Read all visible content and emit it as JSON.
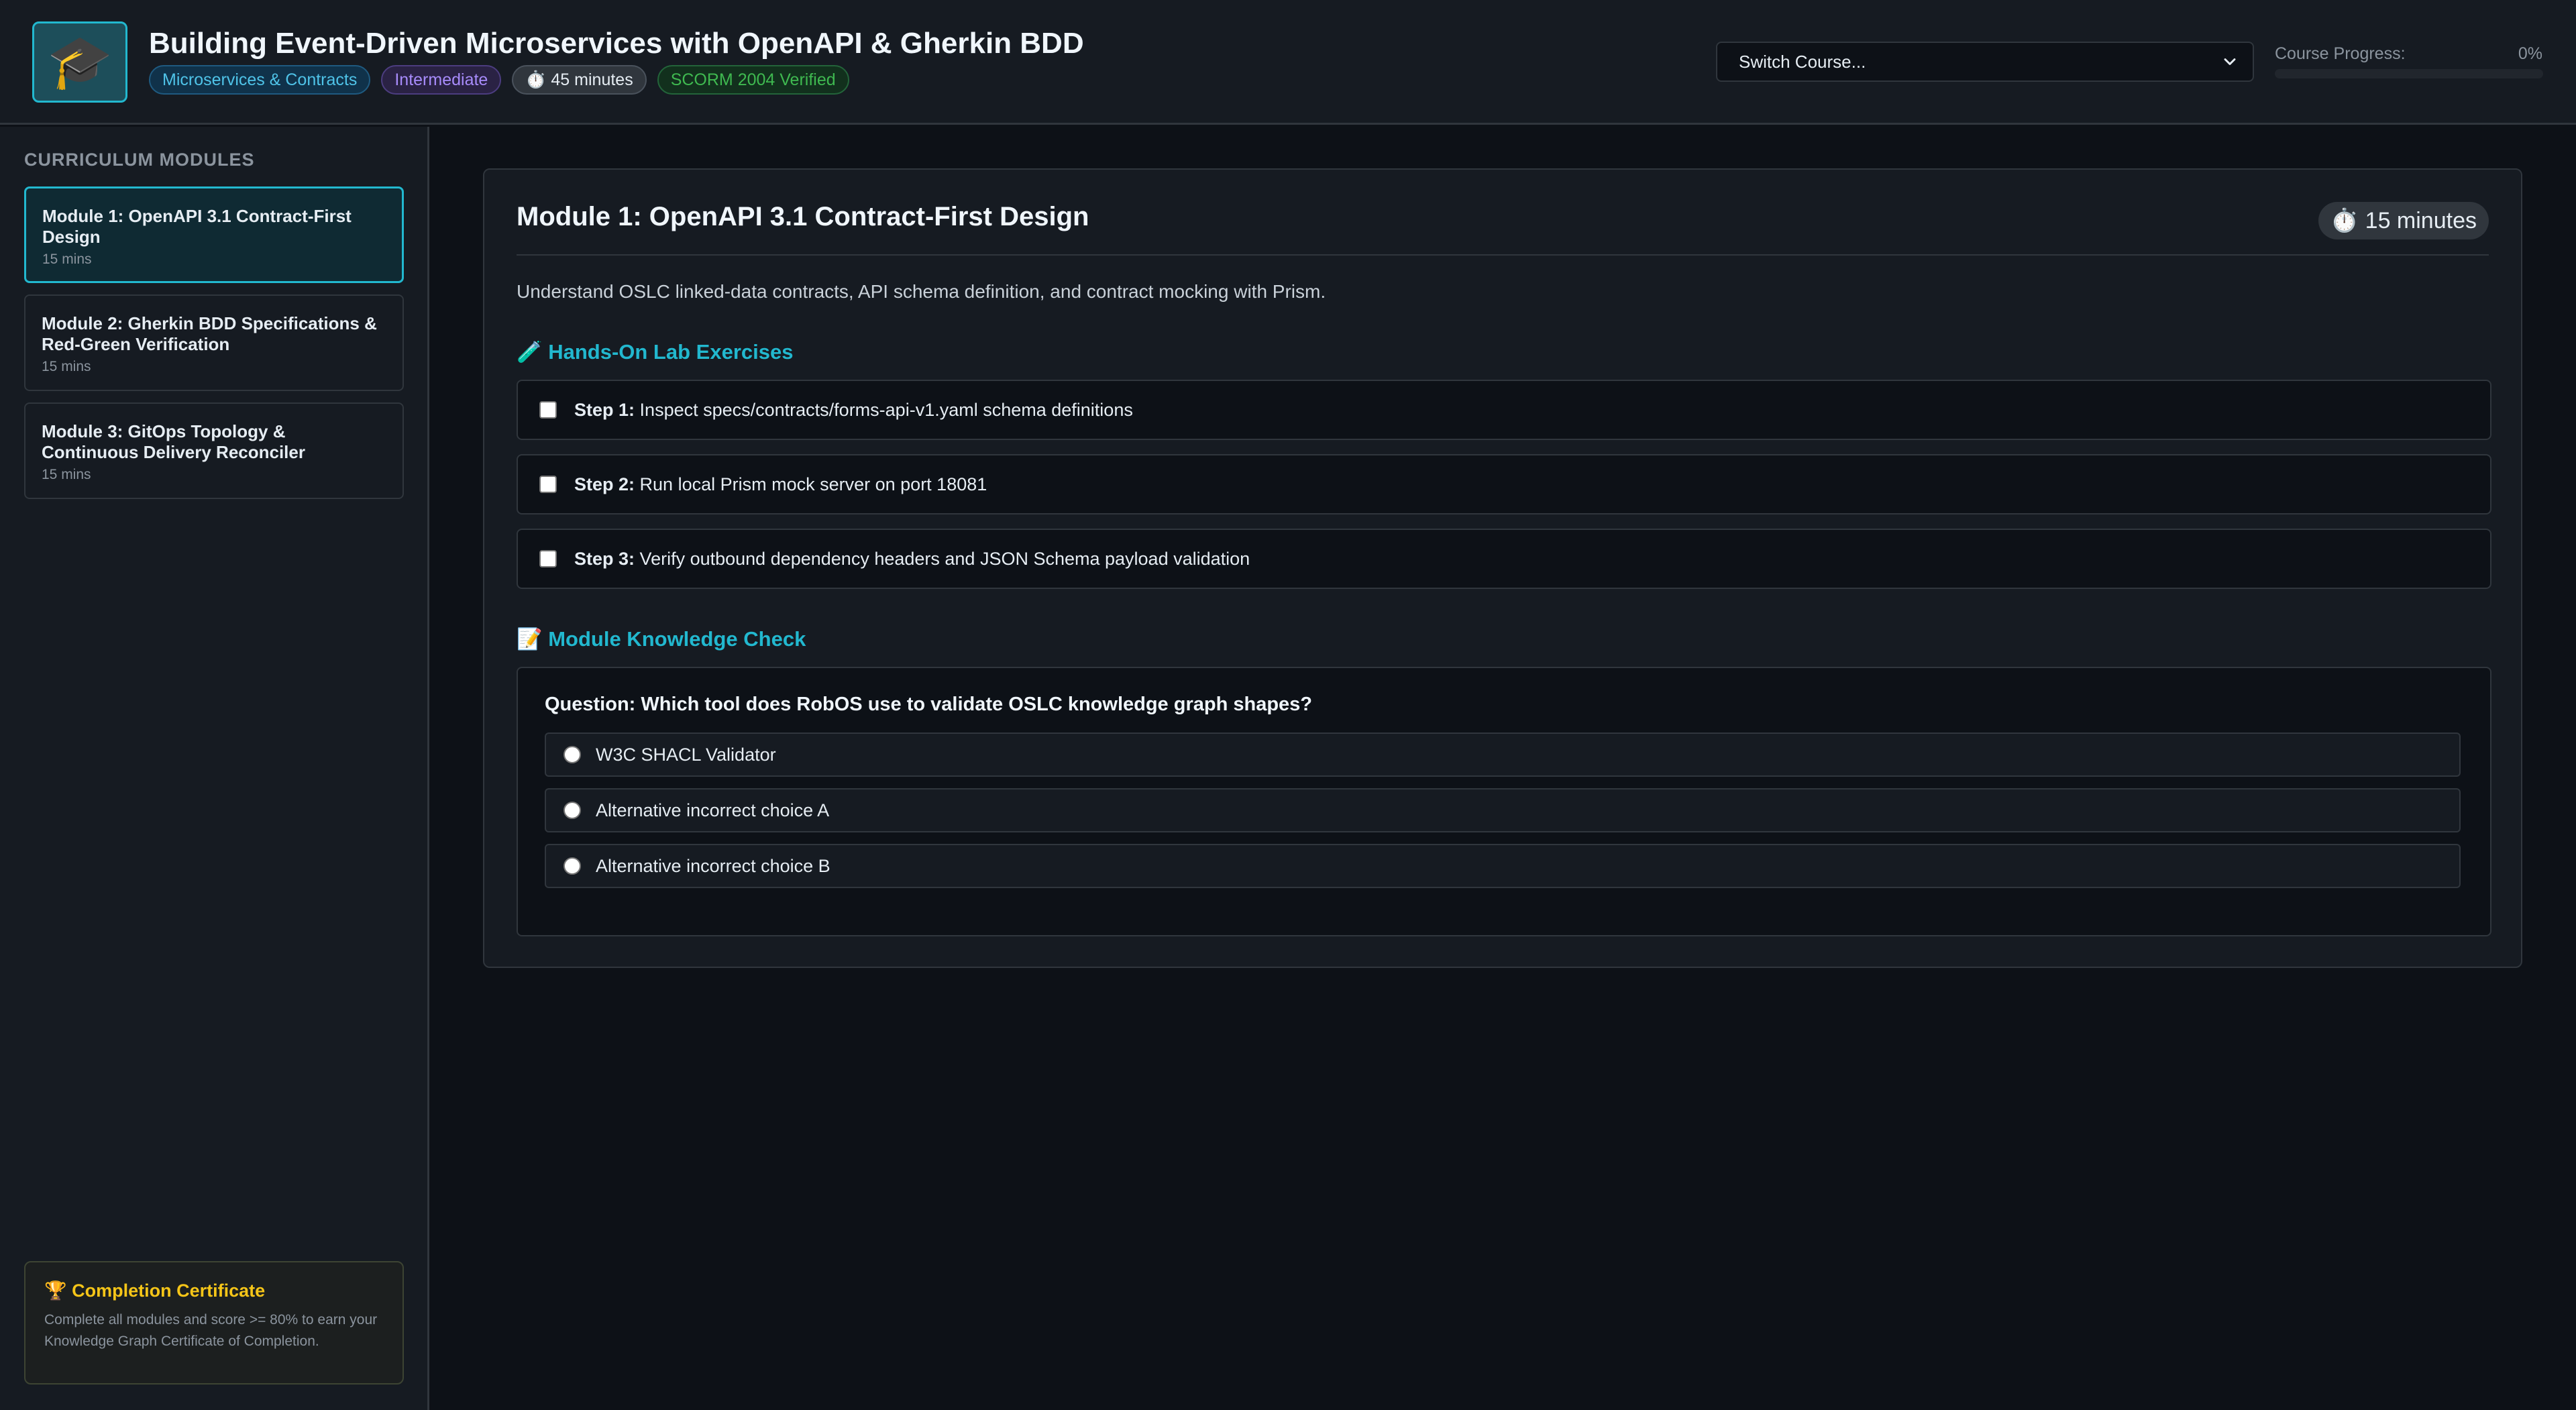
{
  "header": {
    "logo_icon": "graduation-cap-icon",
    "logo_glyph": "🎓",
    "title": "Building Event-Driven Microservices with OpenAPI & Gherkin BDD",
    "badges": {
      "topic": "Microservices & Contracts",
      "level": "Intermediate",
      "duration": "⏱️ 45 minutes",
      "compliance": "SCORM 2004 Verified"
    },
    "switch_course": {
      "label": "Switch Course...",
      "icon": "chevron-down-icon"
    },
    "progress": {
      "label": "Course Progress:",
      "value_text": "0%",
      "fraction": 0
    }
  },
  "sidebar": {
    "heading": "Curriculum Modules",
    "modules": [
      {
        "title": "Module 1: OpenAPI 3.1 Contract-First Design",
        "duration": "15 mins",
        "active": true
      },
      {
        "title": "Module 2: Gherkin BDD Specifications & Red-Green Verification",
        "duration": "15 mins",
        "active": false
      },
      {
        "title": "Module 3: GitOps Topology & Continuous Delivery Reconciler",
        "duration": "15 mins",
        "active": false
      }
    ],
    "certificate": {
      "icon": "trophy-icon",
      "title": "🏆 Completion Certificate",
      "text": "Complete all modules and score >= 80% to earn your Knowledge Graph Certificate of Completion."
    }
  },
  "main": {
    "module_title": "Module 1: OpenAPI 3.1 Contract-First Design",
    "duration": "⏱️ 15 minutes",
    "description": "Understand OSLC linked-data contracts, API schema definition, and contract mocking with Prism.",
    "lab": {
      "heading": "🧪 Hands-On Lab Exercises",
      "steps": [
        {
          "label": "Step 1:",
          "text": "Inspect specs/contracts/forms-api-v1.yaml schema definitions",
          "checked": false
        },
        {
          "label": "Step 2:",
          "text": "Run local Prism mock server on port 18081",
          "checked": false
        },
        {
          "label": "Step 3:",
          "text": "Verify outbound dependency headers and JSON Schema payload validation",
          "checked": false
        }
      ]
    },
    "quiz": {
      "heading": "📝 Module Knowledge Check",
      "question": "Question: Which tool does RobOS use to validate OSLC knowledge graph shapes?",
      "options": [
        "W3C SHACL Validator",
        "Alternative incorrect choice A",
        "Alternative incorrect choice B"
      ]
    }
  },
  "colors": {
    "accent": "#22b8cf",
    "background": "#0d1117",
    "surface": "#161b22",
    "certificate_title": "#f5c518"
  }
}
